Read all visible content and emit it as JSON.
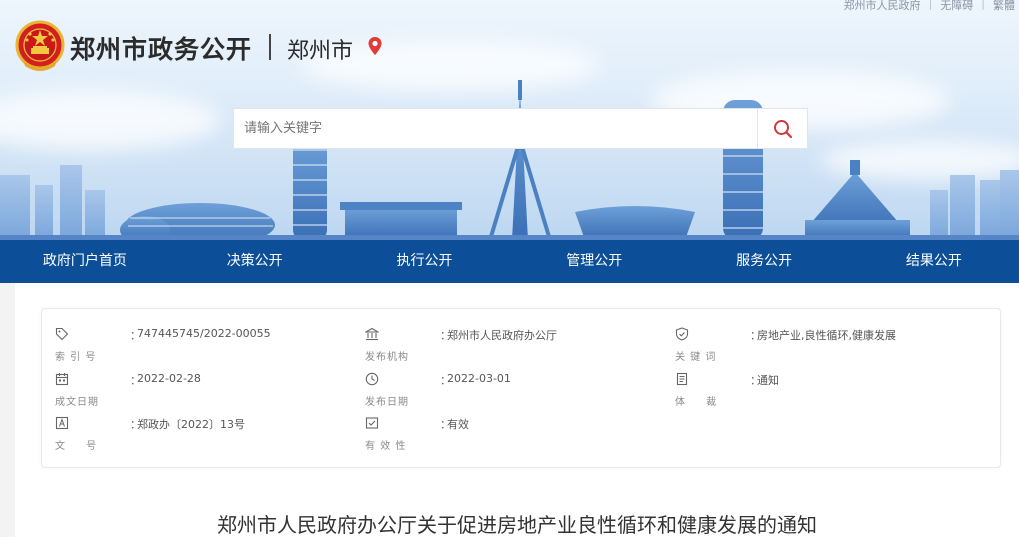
{
  "top_links": [
    "郑州市人民政府",
    "无障碍",
    "繁體"
  ],
  "header": {
    "site_title": "郑州市政务公开",
    "city": "郑州市"
  },
  "search": {
    "placeholder": "请输入关键字"
  },
  "nav": {
    "items": [
      "政府门户首页",
      "决策公开",
      "执行公开",
      "管理公开",
      "服务公开",
      "结果公开"
    ]
  },
  "meta": {
    "index_no": {
      "label": "索 引 号",
      "value": "747445745/2022-00055"
    },
    "publisher": {
      "label": "发布机构",
      "value": "郑州市人民政府办公厅"
    },
    "keywords": {
      "label": "关 键 词",
      "value": "房地产业,良性循环,健康发展"
    },
    "created": {
      "label": "成文日期",
      "value": "2022-02-28"
    },
    "published": {
      "label": "发布日期",
      "value": "2022-03-01"
    },
    "genre": {
      "label": "体 裁",
      "value": "通知"
    },
    "doc_no": {
      "label": "文 号",
      "value": "郑政办〔2022〕13号"
    },
    "validity": {
      "label": "有 效 性",
      "value": "有效"
    },
    "colon": "："
  },
  "document": {
    "title": "郑州市人民政府办公厅关于促进房地产业良性循环和健康发展的通知"
  }
}
